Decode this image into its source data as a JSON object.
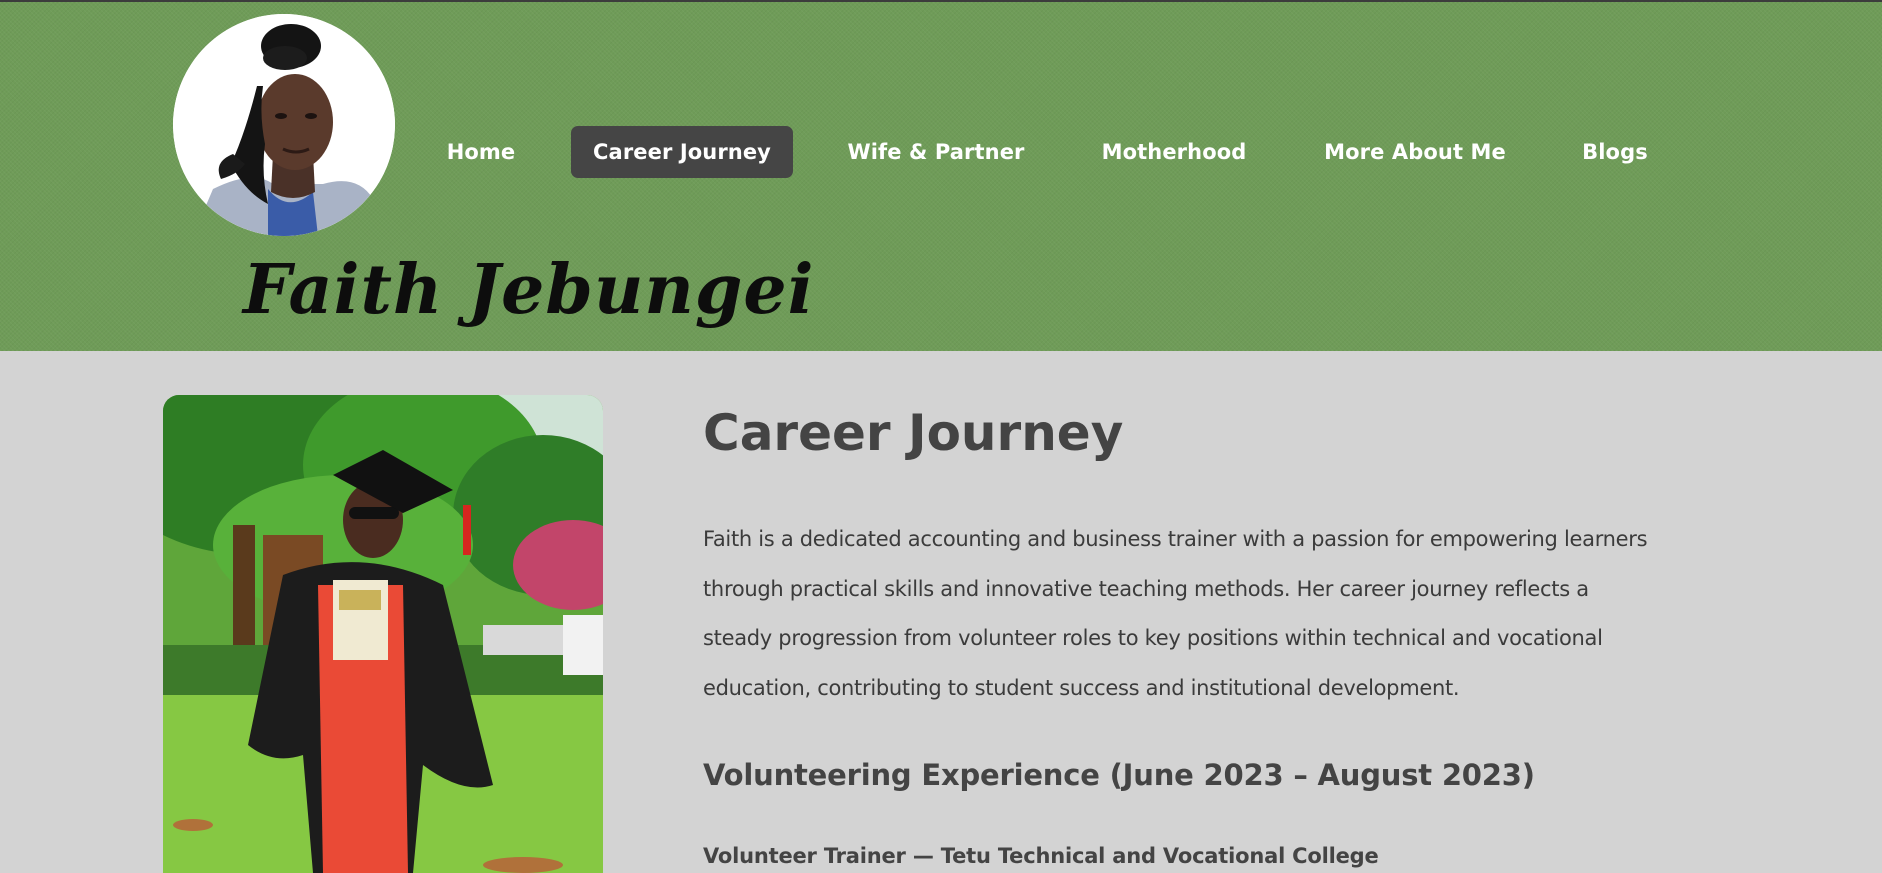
{
  "site": {
    "title": "Faith Jebungei",
    "header_color": "#6f9c58"
  },
  "nav": {
    "items": [
      {
        "label": "Home",
        "active": false
      },
      {
        "label": "Career Journey",
        "active": true
      },
      {
        "label": "Wife & Partner",
        "active": false
      },
      {
        "label": "Motherhood",
        "active": false
      },
      {
        "label": "More About Me",
        "active": false
      },
      {
        "label": "Blogs",
        "active": false
      }
    ],
    "active_color": "#454545"
  },
  "main": {
    "heading": "Career Journey",
    "intro": "Faith is a dedicated accounting and business trainer with a passion for empowering learners through practical skills and innovative teaching methods. Her career journey reflects a steady progression from volunteer roles to key positions within technical and vocational education, contributing to student success and institutional development.",
    "sections": [
      {
        "heading": "Volunteering Experience (June 2023 – August 2023)",
        "role": "Volunteer Trainer — Tetu Technical and Vocational College"
      }
    ]
  },
  "icons": {
    "avatar": "profile-photo",
    "photo": "graduation-photo"
  }
}
